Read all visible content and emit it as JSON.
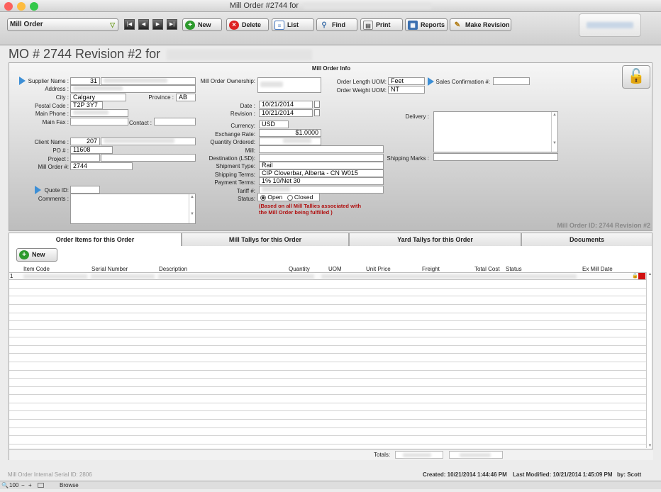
{
  "window": {
    "title": "Mill Order #2744 for"
  },
  "toolbar": {
    "layout_select": "Mill Order",
    "new": "New",
    "delete": "Delete",
    "list": "List",
    "find": "Find",
    "print": "Print",
    "reports": "Reports",
    "make_revision": "Make Revision"
  },
  "heading": "MO # 2744 Revision #2 for",
  "info": {
    "section_title": "Mill Order Info",
    "supplier_name_label": "Supplier Name :",
    "supplier_name": "31",
    "address_label": "Address :",
    "city_label": "City :",
    "city": "Calgary",
    "province_label": "Province :",
    "province": "AB",
    "postal_code_label": "Postal Code :",
    "postal_code": "T2P 3Y7",
    "main_phone_label": "Main Phone :",
    "main_fax_label": "Main Fax :",
    "contact_label": "Contact :",
    "client_name_label": "Client Name :",
    "client_name": "207",
    "po_label": "PO # :",
    "po": "11608",
    "project_label": "Project :",
    "mill_order_label": "Mill Order #:",
    "mill_order": "2744",
    "quote_id_label": "Quote ID:",
    "comments_label": "Comments :",
    "ownership_label": "Mill Order Ownership:",
    "date_label": "Date :",
    "date": "10/21/2014",
    "revision_label": "Revision :",
    "revision": "10/21/2014",
    "currency_label": "Currency:",
    "currency": "USD",
    "exchange_rate_label": "Exchange Rate:",
    "exchange_rate": "$1.0000",
    "quantity_ordered_label": "Quantity Ordered:",
    "mill_label": "Mill:",
    "destination_label": "Destination (LSD):",
    "shipment_type_label": "Shipment Type:",
    "shipment_type": "Rail",
    "shipping_terms_label": "Shipping Terms:",
    "shipping_terms": "CIP Cloverbar, Alberta - CN W015",
    "payment_terms_label": "Payment Terms:",
    "payment_terms": "1% 10/Net 30",
    "tariff_label": "Tariff #:",
    "status_label": "Status:",
    "status_open": "Open",
    "status_closed": "Closed",
    "status_note": "(Based on all Mill Tallies associated with the Mill Order being fulfilled )",
    "length_uom_label": "Order Length UOM:",
    "length_uom": "Feet",
    "weight_uom_label": "Order Weight UOM:",
    "weight_uom": "NT",
    "sales_conf_label": "Sales Confirmation #:",
    "delivery_label": "Delivery :",
    "shipping_marks_label": "Shipping Marks :",
    "mill_order_id": "Mill Order ID: 2744 Revision #2"
  },
  "tabs": [
    "Order Items for this Order",
    "Mill Tallys for this Order",
    "Yard Tallys for this Order",
    "Documents"
  ],
  "portal": {
    "new": "New",
    "columns": [
      "Item Code",
      "Serial Number",
      "Description",
      "Quantity",
      "UOM",
      "Unit Price",
      "Freight",
      "Total Cost",
      "Status",
      "Ex Mill Date"
    ],
    "row_number": "1",
    "totals_label": "Totals:"
  },
  "status": {
    "serial": "Mill Order Internal Serial ID: 2806",
    "created": "Created: 10/21/2014 1:44:46 PM",
    "modified": "Last Modified: 10/21/2014 1:45:09 PM",
    "by": "by: Scott Haderer"
  },
  "bottom": {
    "zoom": "100",
    "mode": "Browse"
  },
  "colors": {
    "accent_arrow": "#3d8fd6",
    "note_red": "#b01010"
  },
  "icons": [
    "new-plus-icon",
    "delete-x-icon",
    "list-icon",
    "find-magnifier-icon",
    "print-icon",
    "reports-icon",
    "make-revision-pencil-icon",
    "lock-icon"
  ]
}
